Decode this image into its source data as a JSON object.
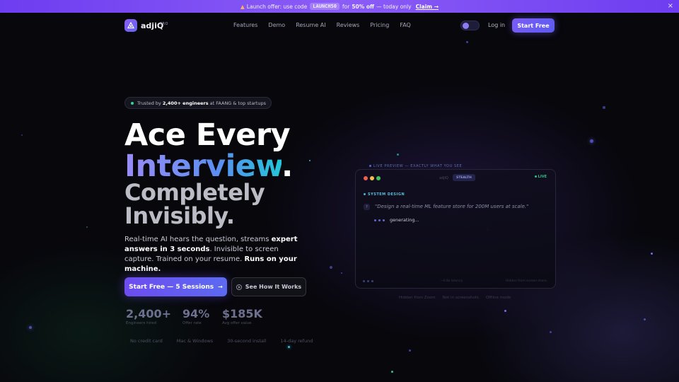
{
  "banner": {
    "fire_icon": "fire-icon",
    "prefix": "Launch offer: use code",
    "code": "LAUNCH50",
    "mid": "for",
    "discount": "50% off",
    "suffix": "— today only",
    "cta": "Claim →",
    "close": "×"
  },
  "header": {
    "logo_icon": "triangle-logo-icon",
    "brand": "adjiQ",
    "badge": "PRO",
    "nav": [
      "Features",
      "Demo",
      "Resume AI",
      "Reviews",
      "Pricing",
      "FAQ"
    ],
    "login": "Log in",
    "start": "Start Free"
  },
  "hero": {
    "pill": {
      "prefix": "Trusted by",
      "highlight": "2,400+ engineers",
      "suffix": "at FAANG & top startups"
    },
    "line1": "Ace Every",
    "line2": "Interview",
    "line2_dot": ".",
    "line3": "Completely Invisibly.",
    "sub": {
      "a": "Real-time AI hears the question, streams",
      "b": "expert answers in 3 seconds",
      "c": ". Invisible to screen capture. Trained on your resume.",
      "d": "Runs on your machine."
    },
    "cta_primary": "Start Free — 5 Sessions",
    "cta_primary_icon": "arrow-right-icon",
    "cta_secondary": "See How It Works",
    "cta_secondary_icon": "play-icon",
    "stats": [
      {
        "value": "2,400+",
        "label": "Engineers hired"
      },
      {
        "value": "94%",
        "label": "Offer rate"
      },
      {
        "value": "$185K",
        "label": "Avg offer value"
      }
    ],
    "features": [
      "No credit card",
      "Mac & Windows",
      "30-second install",
      "14-day refund"
    ]
  },
  "preview": {
    "label": "LIVE PREVIEW — EXACTLY WHAT YOU SEE",
    "window_title": "adjiQ",
    "stealth": "STEALTH",
    "live": "LIVE",
    "category": "SYSTEM DESIGN",
    "question": "\"Design a real-time ML feature store for 200M users at scale.\"",
    "status": "generating...",
    "footer_mid": "~0.8s latency",
    "footer_right": "Hidden from screen share",
    "under": [
      "Hidden from Zoom",
      "Not in screenshots",
      "Offline mode"
    ]
  },
  "colors": {
    "accent": "#7c5cf6",
    "banner": "#8b5cf6",
    "live_green": "#2fbf86",
    "cyan": "#22c5d8"
  }
}
